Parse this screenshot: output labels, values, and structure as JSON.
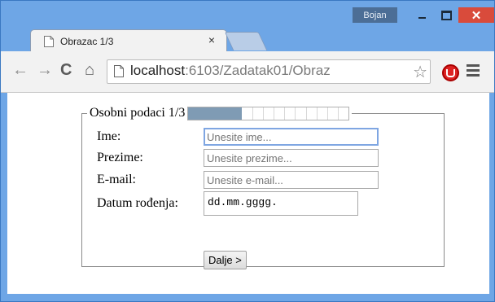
{
  "window": {
    "user": "Bojan",
    "close_glyph": "✕"
  },
  "tab": {
    "title": "Obrazac 1/3",
    "close_glyph": "×"
  },
  "toolbar": {
    "back_glyph": "←",
    "forward_glyph": "→",
    "reload_glyph": "C",
    "home_glyph": "⌂",
    "url_host": "localhost",
    "url_path": ":6103/Zadatak01/Obraz",
    "star_glyph": "☆"
  },
  "form": {
    "legend": "Osobni podaci 1/3",
    "progress_fraction": 0.333,
    "fields": {
      "ime": {
        "label": "Ime:",
        "placeholder": "Unesite ime..."
      },
      "prezime": {
        "label": "Prezime:",
        "placeholder": "Unesite prezime..."
      },
      "email": {
        "label": "E-mail:",
        "placeholder": "Unesite e-mail..."
      },
      "datum": {
        "label": "Datum rođenja:",
        "value": "dd.mm.gggg."
      }
    },
    "submit_label": "Dalje >"
  }
}
